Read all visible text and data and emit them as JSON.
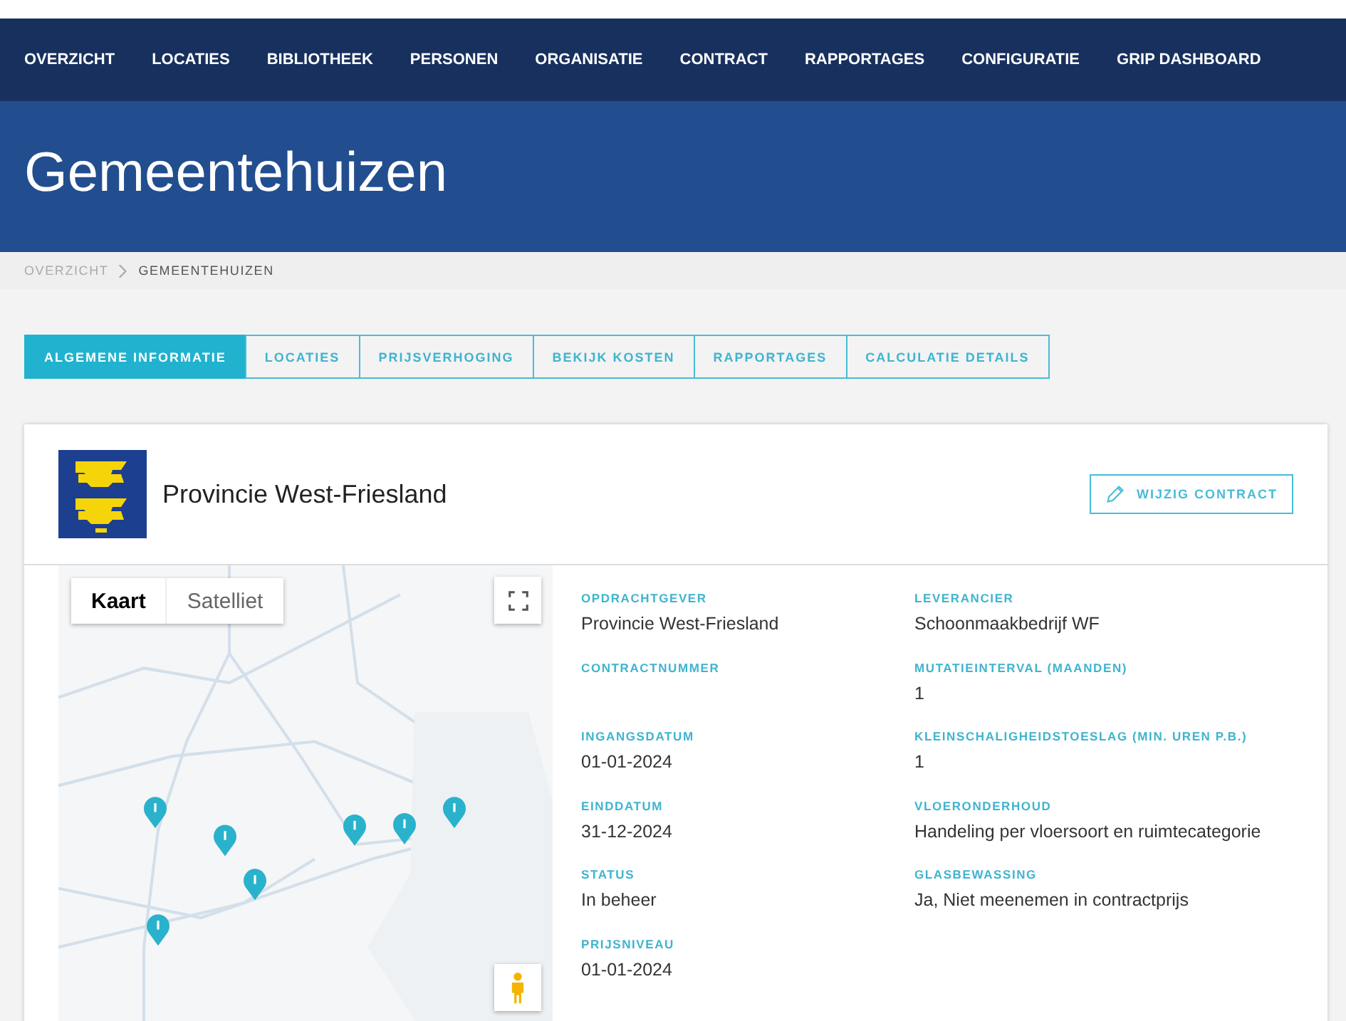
{
  "nav": {
    "items": [
      "OVERZICHT",
      "LOCATIES",
      "BIBLIOTHEEK",
      "PERSONEN",
      "ORGANISATIE",
      "CONTRACT",
      "RAPPORTAGES",
      "CONFIGURATIE",
      "GRIP DASHBOARD"
    ]
  },
  "page_title": "Gemeentehuizen",
  "breadcrumb": [
    {
      "label": "OVERZICHT",
      "current": false
    },
    {
      "label": "GEMEENTEHUIZEN",
      "current": true
    }
  ],
  "tabs": [
    {
      "label": "ALGEMENE INFORMATIE",
      "selected": true
    },
    {
      "label": "LOCATIES",
      "selected": false
    },
    {
      "label": "PRIJSVERHOGING",
      "selected": false
    },
    {
      "label": "BEKIJK KOSTEN",
      "selected": false
    },
    {
      "label": "RAPPORTAGES",
      "selected": false
    },
    {
      "label": "CALCULATIE DETAILS",
      "selected": false
    }
  ],
  "card": {
    "title": "Provincie West-Friesland",
    "edit_button": "WIJZIG CONTRACT"
  },
  "map": {
    "types": [
      {
        "label": "Kaart",
        "selected": true
      },
      {
        "label": "Satelliet",
        "selected": false
      }
    ]
  },
  "details": {
    "column_1": [
      {
        "label": "OPDRACHTGEVER",
        "value": "Provincie West-Friesland"
      },
      {
        "label": "CONTRACTNUMMER"
      },
      {
        "label": "INGANGSDATUM",
        "value": "01-01-2024"
      },
      {
        "label": "EINDDATUM",
        "value": "31-12-2024"
      },
      {
        "label": "STATUS",
        "value": "In beheer"
      },
      {
        "label": "PRIJSNIVEAU",
        "value": "01-01-2024"
      }
    ],
    "column_2": [
      {
        "label": "LEVERANCIER",
        "value": "Schoonmaakbedrijf WF"
      },
      {
        "label": "MUTATIEINTERVAL (MAANDEN)",
        "value": "1"
      },
      {
        "label": "KLEINSCHALIGHEIDSTOESLAG (MIN. UREN P.B.)",
        "value": "1"
      },
      {
        "label": "VLOERONDERHOUD",
        "value": "Handeling per vloersoort en ruimtecategorie"
      },
      {
        "label": "GLASBEWASSING",
        "value": "Ja, Niet meenemen in contractprijs"
      }
    ]
  }
}
